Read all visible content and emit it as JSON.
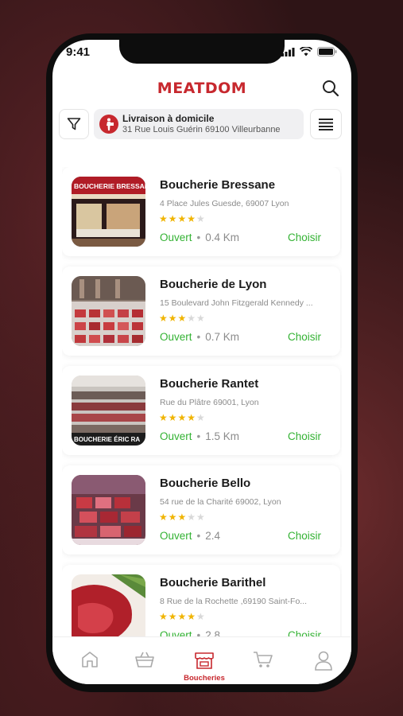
{
  "status_bar": {
    "time": "9:41"
  },
  "header": {
    "logo": "MEATDOM"
  },
  "delivery": {
    "title": "Livraison à domicile",
    "address": "31 Rue Louis Guérin 69100 Villeurbanne"
  },
  "butchers": [
    {
      "name": "Boucherie Bressane",
      "address": "4 Place Jules Guesde, 69007 Lyon",
      "rating": 4,
      "status": "Ouvert",
      "distance": "0.4 Km",
      "action": "Choisir",
      "sign": "BOUCHERIE BRESSANE"
    },
    {
      "name": "Boucherie de Lyon",
      "address": "15 Boulevard John Fitzgerald Kennedy ...",
      "rating": 3,
      "status": "Ouvert",
      "distance": "0.7 Km",
      "action": "Choisir"
    },
    {
      "name": "Boucherie Rantet",
      "address": "Rue du Plâtre 69001, Lyon",
      "rating": 4,
      "status": "Ouvert",
      "distance": "1.5 Km",
      "action": "Choisir",
      "sign": "BOUCHERIE ÉRIC RA"
    },
    {
      "name": "Boucherie Bello",
      "address": "54 rue de la Charité 69002, Lyon",
      "rating": 3,
      "status": "Ouvert",
      "distance": "2.4",
      "action": "Choisir"
    },
    {
      "name": "Boucherie Barithel",
      "address": "8 Rue de la Rochette ,69190 Saint-Fo...",
      "rating": 4,
      "status": "Ouvert",
      "distance": "2.8",
      "action": "Choisir"
    }
  ],
  "tabbar": {
    "active_label": "Boucheries"
  },
  "colors": {
    "brand": "#c7282e",
    "open": "#33b233",
    "star": "#f0b400"
  }
}
